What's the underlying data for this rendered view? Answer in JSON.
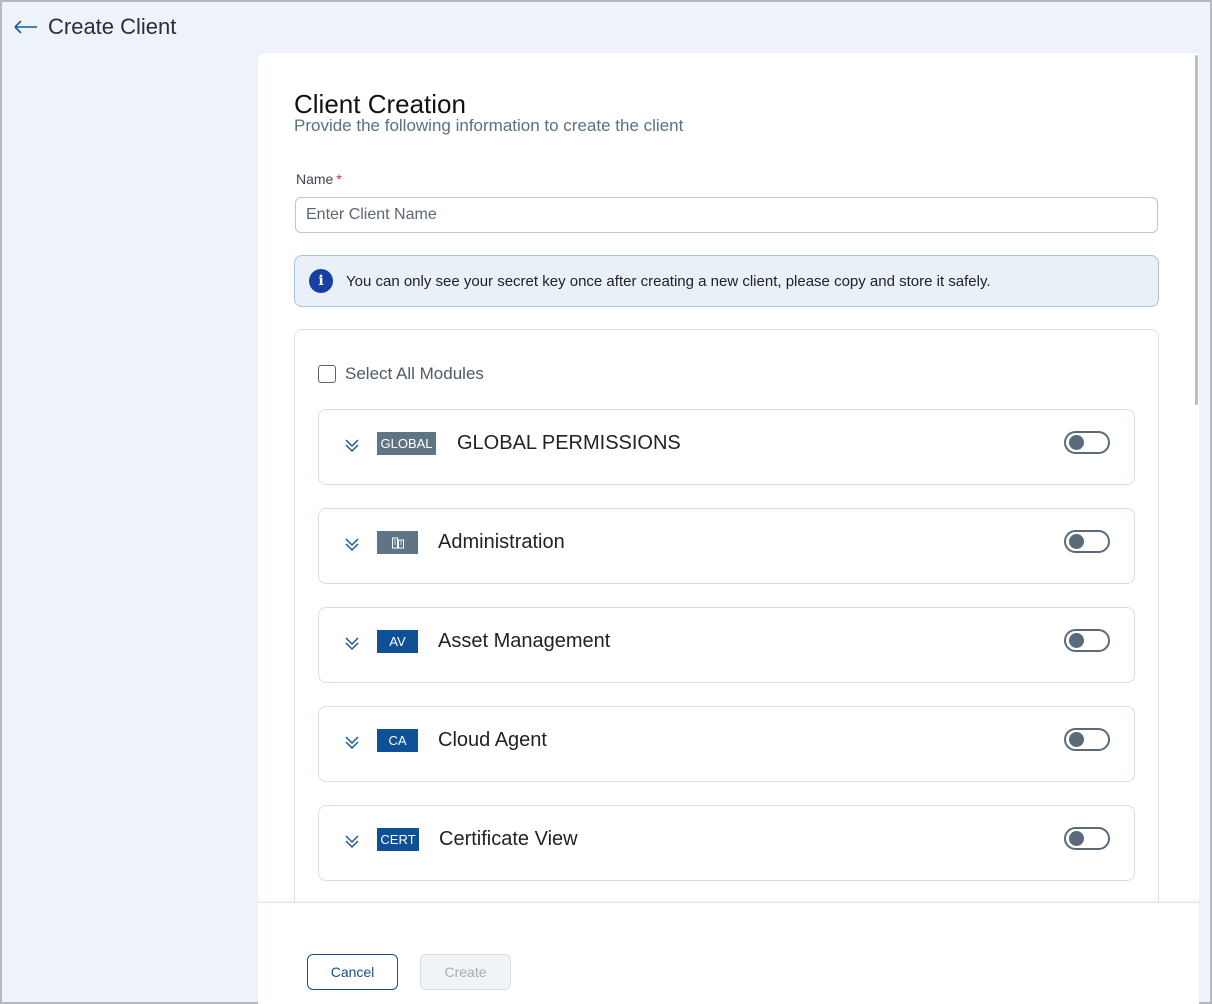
{
  "header": {
    "title": "Create Client",
    "back_icon": "arrow-left-icon"
  },
  "form": {
    "title": "Client Creation",
    "subtitle": "Provide the following information to create the client",
    "name_label": "Name",
    "required_marker": "*",
    "name_placeholder": "Enter Client Name",
    "name_value": ""
  },
  "info": {
    "icon": "info-icon",
    "icon_glyph": "i",
    "text": "You can only see your secret key once after creating a new client, please copy and store it safely."
  },
  "modules": {
    "select_all_label": "Select All Modules",
    "select_all_checked": false,
    "items": [
      {
        "badge": "GLOBAL",
        "badge_color": "#5f7585",
        "label": "GLOBAL PERMISSIONS",
        "enabled": false
      },
      {
        "badge": "",
        "badge_icon": "building-icon",
        "badge_color": "#5f7585",
        "label": "Administration",
        "enabled": false
      },
      {
        "badge": "AV",
        "badge_color": "#0e5196",
        "label": "Asset Management",
        "enabled": false
      },
      {
        "badge": "CA",
        "badge_color": "#0e5196",
        "label": "Cloud Agent",
        "enabled": false
      },
      {
        "badge": "CERT",
        "badge_color": "#0e5196",
        "label": "Certificate View",
        "enabled": false
      }
    ]
  },
  "footer": {
    "cancel_label": "Cancel",
    "create_label": "Create",
    "create_disabled": true
  },
  "colors": {
    "accent": "#1a4d8f",
    "background": "#eef3f9",
    "info_bg": "#e9f0f8",
    "required": "#d92d2d"
  }
}
